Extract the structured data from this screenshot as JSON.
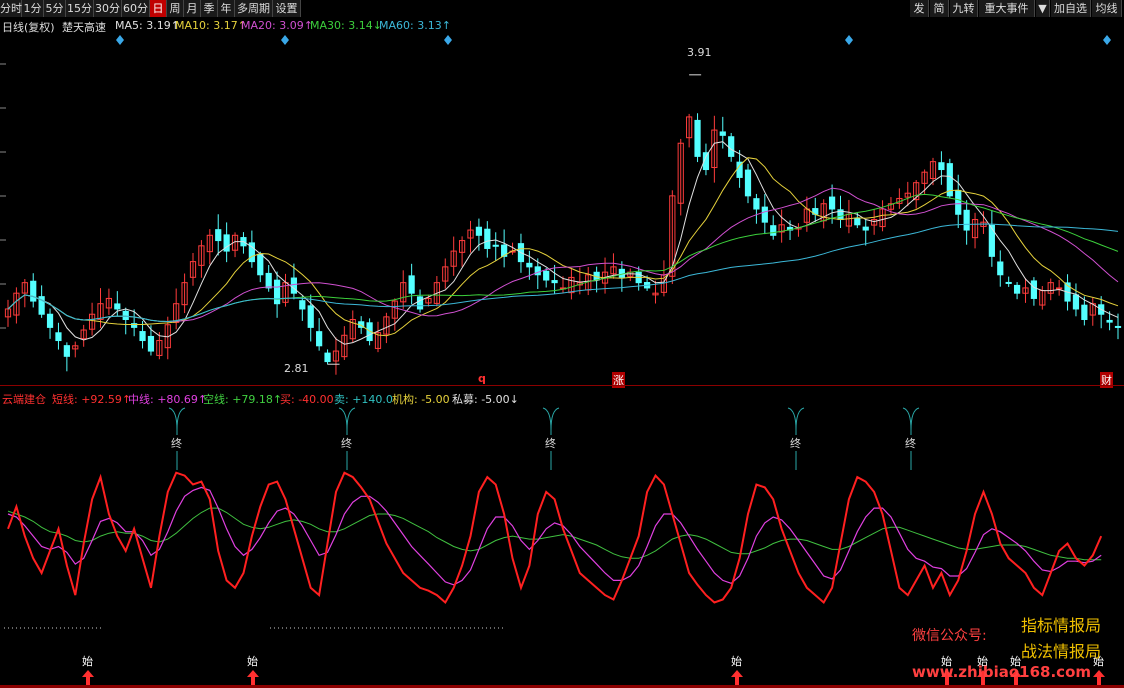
{
  "toolbar": {
    "left_buttons": [
      {
        "label": "分时",
        "name": "tab-intraday"
      },
      {
        "label": "1分",
        "name": "tab-1min"
      },
      {
        "label": "5分",
        "name": "tab-5min"
      },
      {
        "label": "15分",
        "name": "tab-15min"
      },
      {
        "label": "30分",
        "name": "tab-30min"
      },
      {
        "label": "60分",
        "name": "tab-60min"
      },
      {
        "label": "日",
        "name": "tab-day",
        "active": true
      },
      {
        "label": "周",
        "name": "tab-week"
      },
      {
        "label": "月",
        "name": "tab-month"
      },
      {
        "label": "季",
        "name": "tab-quarter"
      },
      {
        "label": "年",
        "name": "tab-year"
      },
      {
        "label": "多周期",
        "name": "tab-multi-period"
      },
      {
        "label": "设置",
        "name": "settings-button"
      }
    ],
    "right_buttons": [
      {
        "label": "发",
        "name": "tool-fa-button"
      },
      {
        "label": "简",
        "name": "tool-jian-button"
      },
      {
        "label": "九转",
        "name": "tool-jiuzhuan-button"
      },
      {
        "label": "重大事件",
        "name": "major-events-button"
      },
      {
        "label": "▼",
        "name": "dropdown-arrow-button"
      },
      {
        "label": "加自选",
        "name": "add-watchlist-button"
      },
      {
        "label": "均线",
        "name": "moving-average-button"
      }
    ]
  },
  "price_panel": {
    "title": "日线(复权)",
    "stock_name": "楚天高速",
    "ma": [
      {
        "label": "MA5: 3.19↑",
        "color": "#e0e0e0"
      },
      {
        "label": "MA10: 3.17↑",
        "color": "#e6d23c"
      },
      {
        "label": "MA20: 3.09↑",
        "color": "#d050d0"
      },
      {
        "label": "MA30: 3.14↓",
        "color": "#3cd03c"
      },
      {
        "label": "MA60: 3.13↑",
        "color": "#3cb8d8"
      }
    ],
    "high_label": "3.91",
    "low_label": "2.81",
    "markers": [
      {
        "text": "q",
        "color": "#ff3030"
      },
      {
        "text": "涨",
        "color": "#ffffff",
        "bg": "#b00000"
      },
      {
        "text": "财",
        "color": "#ffffff",
        "bg": "#b00000"
      }
    ]
  },
  "indicator_panel": {
    "name": "云端建仓",
    "values": [
      {
        "label": "短线: +92.59↑",
        "color": "#ff3030"
      },
      {
        "label": "中线: +80.69↑",
        "color": "#e040e0"
      },
      {
        "label": "空线: +79.18↑",
        "color": "#40d040"
      },
      {
        "label": "买: -40.00",
        "color": "#ff3030"
      },
      {
        "label": "卖: +140.0",
        "color": "#30c0c0"
      },
      {
        "label": "机构: -5.00",
        "color": "#e6d23c"
      },
      {
        "label": "私募: -5.00↓",
        "color": "#e0e0e0"
      }
    ],
    "end_label": "终",
    "start_label": "始"
  },
  "watermark": {
    "line1": "指标情报局",
    "line2": "战法情报局",
    "wechat": "微信公众号:",
    "site": "www.zhibiao168.com"
  },
  "colors": {
    "up": "#ff3c3c",
    "down": "#54ffff",
    "ma5": "#e0e0e0",
    "ma10": "#e6d23c",
    "ma20": "#d050d0",
    "ma30": "#3cd03c",
    "ma60": "#3cb8d8",
    "short_line": "#ff2020",
    "mid_line": "#e040e0",
    "empty_line": "#40c040",
    "end_line": "#2aa8a8"
  },
  "chart_data": {
    "type": "candlestick",
    "price_range": [
      2.75,
      4.05
    ],
    "closes": [
      3.02,
      3.08,
      3.12,
      3.05,
      3.0,
      2.95,
      2.9,
      2.84,
      2.88,
      2.94,
      3.0,
      3.04,
      3.06,
      3.02,
      2.98,
      2.95,
      2.9,
      2.86,
      2.9,
      2.96,
      3.04,
      3.12,
      3.2,
      3.26,
      3.3,
      3.28,
      3.24,
      3.3,
      3.26,
      3.2,
      3.15,
      3.1,
      3.04,
      3.12,
      3.08,
      3.02,
      2.95,
      2.88,
      2.82,
      2.86,
      2.92,
      2.98,
      2.95,
      2.9,
      2.93,
      2.99,
      3.05,
      3.12,
      3.08,
      3.02,
      3.06,
      3.12,
      3.18,
      3.24,
      3.28,
      3.32,
      3.3,
      3.25,
      3.26,
      3.22,
      3.24,
      3.2,
      3.18,
      3.15,
      3.13,
      3.12,
      3.1,
      3.14,
      3.12,
      3.15,
      3.13,
      3.16,
      3.18,
      3.14,
      3.16,
      3.12,
      3.1,
      3.08,
      3.15,
      3.45,
      3.65,
      3.75,
      3.6,
      3.55,
      3.7,
      3.68,
      3.6,
      3.52,
      3.45,
      3.4,
      3.35,
      3.3,
      3.34,
      3.32,
      3.33,
      3.4,
      3.38,
      3.42,
      3.4,
      3.36,
      3.38,
      3.34,
      3.32,
      3.36,
      3.4,
      3.42,
      3.44,
      3.46,
      3.5,
      3.54,
      3.58,
      3.55,
      3.45,
      3.38,
      3.32,
      3.36,
      3.35,
      3.22,
      3.15,
      3.12,
      3.08,
      3.1,
      3.06,
      3.09,
      3.12,
      3.1,
      3.05,
      3.02,
      2.98,
      3.04,
      3.0,
      2.97,
      2.95
    ],
    "high": {
      "value": 3.91
    },
    "low": {
      "value": 2.81
    },
    "indicator": {
      "range": [
        -10,
        110
      ],
      "short": [
        60,
        75,
        55,
        40,
        30,
        45,
        60,
        35,
        15,
        50,
        80,
        95,
        70,
        55,
        45,
        60,
        40,
        20,
        55,
        85,
        98,
        96,
        90,
        92,
        80,
        45,
        25,
        20,
        30,
        55,
        75,
        90,
        92,
        80,
        60,
        40,
        20,
        15,
        50,
        85,
        98,
        95,
        88,
        80,
        65,
        50,
        40,
        30,
        25,
        20,
        18,
        15,
        10,
        20,
        35,
        55,
        85,
        95,
        90,
        70,
        40,
        20,
        35,
        70,
        85,
        80,
        60,
        45,
        30,
        25,
        20,
        15,
        12,
        25,
        40,
        55,
        85,
        96,
        90,
        70,
        50,
        30,
        22,
        15,
        10,
        12,
        20,
        40,
        70,
        90,
        88,
        80,
        60,
        45,
        30,
        20,
        15,
        10,
        20,
        50,
        80,
        95,
        92,
        85,
        70,
        45,
        20,
        15,
        25,
        35,
        20,
        30,
        15,
        25,
        45,
        70,
        85,
        70,
        50,
        40,
        35,
        30,
        20,
        15,
        30,
        45,
        50,
        40,
        35,
        42,
        55
      ],
      "mid": [
        70,
        68,
        62,
        55,
        48,
        46,
        48,
        44,
        36,
        40,
        52,
        65,
        67,
        64,
        58,
        58,
        52,
        42,
        46,
        58,
        72,
        82,
        86,
        88,
        86,
        74,
        60,
        48,
        42,
        46,
        54,
        64,
        72,
        74,
        70,
        62,
        52,
        42,
        44,
        56,
        70,
        78,
        82,
        82,
        78,
        72,
        64,
        56,
        48,
        42,
        36,
        30,
        24,
        22,
        25,
        32,
        46,
        60,
        68,
        68,
        62,
        52,
        46,
        52,
        60,
        64,
        62,
        56,
        48,
        42,
        36,
        30,
        25,
        25,
        28,
        35,
        48,
        62,
        70,
        70,
        64,
        55,
        46,
        38,
        30,
        25,
        23,
        28,
        40,
        55,
        64,
        68,
        66,
        60,
        52,
        44,
        36,
        28,
        26,
        32,
        45,
        58,
        68,
        74,
        74,
        68,
        57,
        46,
        40,
        38,
        34,
        33,
        28,
        28,
        33,
        44,
        56,
        60,
        58,
        54,
        50,
        45,
        38,
        32,
        31,
        34,
        38,
        38,
        37,
        38,
        42
      ],
      "empty": [
        72,
        70,
        68,
        65,
        61,
        58,
        57,
        55,
        52,
        51,
        52,
        55,
        57,
        58,
        57,
        57,
        55,
        52,
        51,
        53,
        57,
        62,
        67,
        71,
        74,
        74,
        71,
        67,
        63,
        61,
        60,
        61,
        63,
        65,
        66,
        65,
        63,
        60,
        58,
        58,
        60,
        63,
        66,
        69,
        70,
        70,
        69,
        67,
        64,
        61,
        58,
        54,
        51,
        48,
        46,
        45,
        46,
        49,
        52,
        54,
        55,
        54,
        53,
        53,
        54,
        55,
        56,
        55,
        53,
        51,
        49,
        46,
        43,
        41,
        40,
        40,
        42,
        45,
        49,
        53,
        55,
        56,
        55,
        53,
        50,
        47,
        44,
        43,
        43,
        45,
        47,
        50,
        52,
        53,
        53,
        52,
        50,
        48,
        46,
        46,
        48,
        51,
        54,
        57,
        60,
        61,
        61,
        59,
        57,
        55,
        53,
        51,
        49,
        47,
        46,
        46,
        47,
        48,
        49,
        49,
        49,
        48,
        46,
        44,
        42,
        41,
        40,
        40,
        39,
        39,
        39
      ]
    }
  }
}
